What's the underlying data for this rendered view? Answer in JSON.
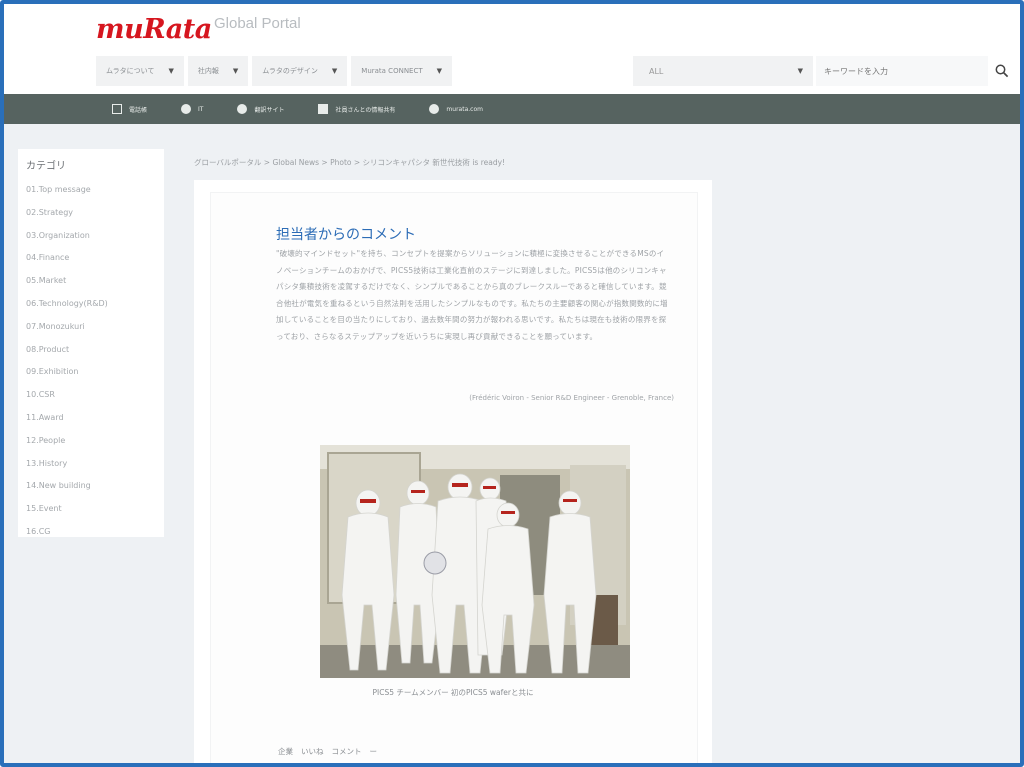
{
  "header": {
    "logo_text": "muRata",
    "portal_title": "Global Portal",
    "menu": [
      {
        "label": "ムラタについて"
      },
      {
        "label": "社内報"
      },
      {
        "label": "ムラタのデザイン"
      },
      {
        "label": "Murata CONNECT"
      }
    ],
    "search_scope": "ALL",
    "search_placeholder": "キーワードを入力"
  },
  "quickbar": {
    "items": [
      {
        "label": "電話帳",
        "icon": "book-icon"
      },
      {
        "label": "IT",
        "icon": "circle-icon"
      },
      {
        "label": "翻訳サイト",
        "icon": "check-circle-icon"
      },
      {
        "label": "社員さんとの情報共有",
        "icon": "square-icon"
      },
      {
        "label": "murata.com",
        "icon": "globe-icon"
      }
    ]
  },
  "sidebar": {
    "title": "カテゴリ",
    "items": [
      "01.Top message",
      "02.Strategy",
      "03.Organization",
      "04.Finance",
      "05.Market",
      "06.Technology(R&D)",
      "07.Monozukuri",
      "08.Product",
      "09.Exhibition",
      "10.CSR",
      "11.Award",
      "12.People",
      "13.History",
      "14.New building",
      "15.Event",
      "16.CG"
    ]
  },
  "breadcrumb": "グローバルポータル > Global News > Photo > シリコンキャパシタ 新世代技術 is ready!",
  "article": {
    "heading": "担当者からのコメント",
    "body": "\"破壊的マインドセット\"を持ち、コンセプトを提案からソリューションに積極に変換させることができるMSのイノベーションチームのおかげで、PICS5技術は工業化直前のステージに到達しました。PICS5は他のシリコンキャパシタ集積技術を凌駕するだけでなく、シンプルであることから真のブレークスルーであると確信しています。競合他社が電気を重ねるという自然法則を活用したシンプルなものです。私たちの主要顧客の関心が指数関数的に増加していることを目の当たりにしており、過去数年間の努力が報われる思いです。私たちは現在も技術の限界を探っており、さらなるステップアップを近いうちに実現し再び貢献できることを願っています。",
    "signature": "(Frédéric Voiron - Senior R&D Engineer - Grenoble, France)",
    "caption": "PICS5 チームメンバー 初のPICS5 waferと共に",
    "footer": [
      "企業",
      "いいね",
      "コメント",
      "ー"
    ]
  }
}
